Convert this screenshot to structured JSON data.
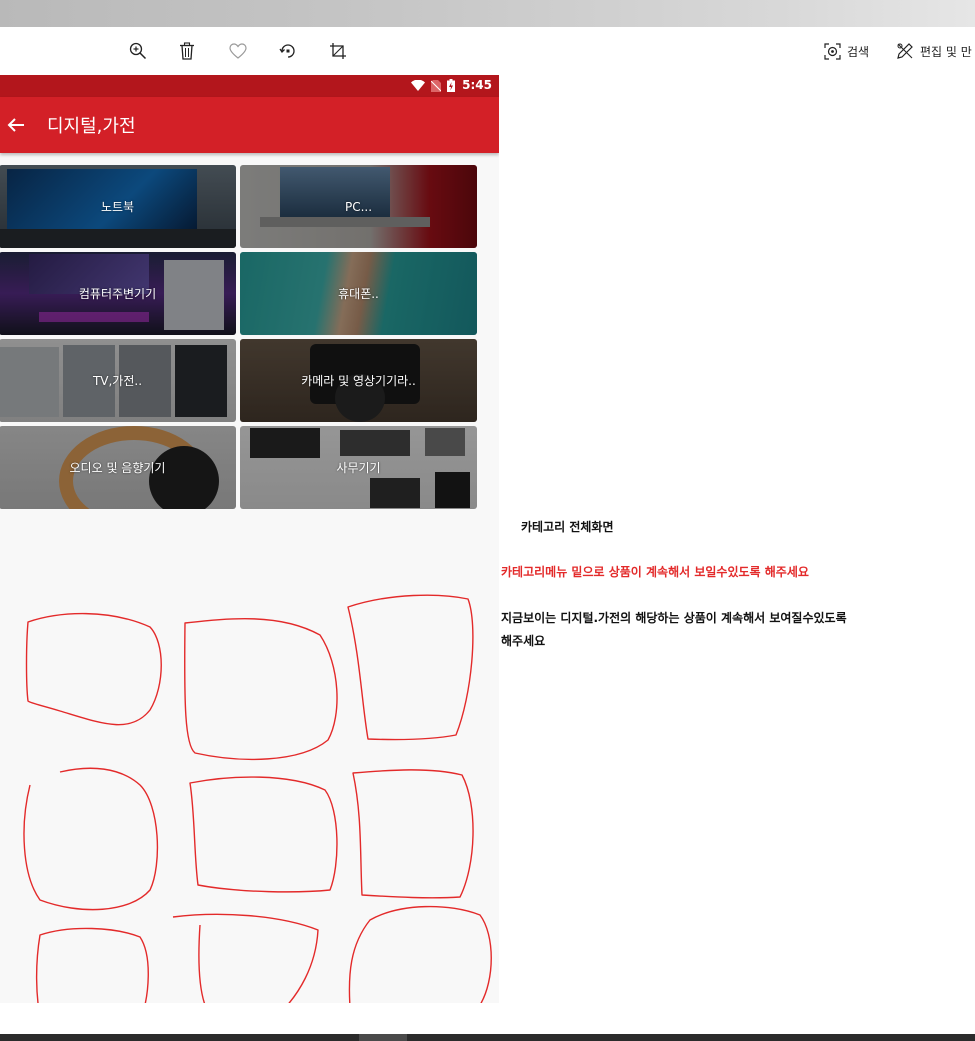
{
  "viewer": {
    "toolbar_icons": [
      "zoom-in-icon",
      "trash-icon",
      "heart-icon",
      "rotate-icon",
      "crop-icon"
    ],
    "search_label": "검색",
    "edit_label": "편집 및 만"
  },
  "phone": {
    "status": {
      "time": "5:45",
      "icons": [
        "wifi-icon",
        "no-sim-icon",
        "battery-charging-icon"
      ]
    },
    "app_bar": {
      "title": "디지털,가전",
      "back_icon": "arrow-left-icon"
    },
    "categories": [
      {
        "label": "노트북"
      },
      {
        "label": "PC..."
      },
      {
        "label": "컴퓨터주변기기"
      },
      {
        "label": "휴대폰.."
      },
      {
        "label": "TV,가전.."
      },
      {
        "label": "카메라 및 영상기기라.."
      },
      {
        "label": "오디오 및 음향기기"
      },
      {
        "label": "사무기기"
      }
    ]
  },
  "notes": {
    "heading": "카테고리 전체화면",
    "red_note": "카테고리메뉴 밑으로 상품이 계속해서 보일수있도록 해주세요",
    "line1": "지금보이는 디지털.가전의 해당하는 상품이 계속해서 보여질수있도록",
    "line2": "해주세요"
  },
  "colors": {
    "status_bar": "#b3161c",
    "app_bar": "#d32027",
    "annotation_red": "#e32a2a"
  }
}
